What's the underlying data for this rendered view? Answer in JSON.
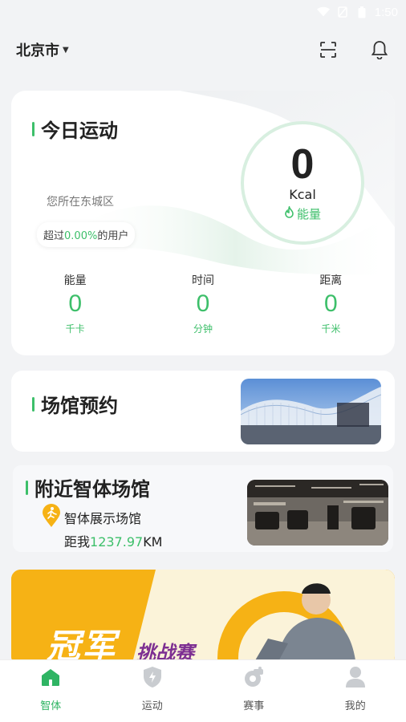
{
  "status_bar": {
    "time": "1:50"
  },
  "header": {
    "city": "北京市"
  },
  "today": {
    "title": "今日运动",
    "location_text": "您所在东城区",
    "beat_prefix": "超过",
    "beat_percent": "0.00%",
    "beat_suffix": "的用户",
    "kcal_value": "0",
    "kcal_unit": "Kcal",
    "energy_label": "能量",
    "stats": [
      {
        "label": "能量",
        "value": "0",
        "unit": "千卡"
      },
      {
        "label": "时间",
        "value": "0",
        "unit": "分钟"
      },
      {
        "label": "距离",
        "value": "0",
        "unit": "千米"
      }
    ]
  },
  "venue_booking": {
    "title": "场馆预约"
  },
  "nearby": {
    "title": "附近智体场馆",
    "venue_name": "智体展示场馆",
    "distance_prefix": "距我",
    "distance_value": "1237.97",
    "distance_unit": "KM"
  },
  "banner": {
    "title": "冠军",
    "subtitle": "挑战赛"
  },
  "tabs": [
    {
      "label": "智体",
      "active": true,
      "icon": "home-icon"
    },
    {
      "label": "运动",
      "active": false,
      "icon": "sport-shield-icon"
    },
    {
      "label": "赛事",
      "active": false,
      "icon": "whistle-icon"
    },
    {
      "label": "我的",
      "active": false,
      "icon": "user-icon"
    }
  ],
  "colors": {
    "accent": "#3dbf6a",
    "banner": "#f6b215"
  }
}
